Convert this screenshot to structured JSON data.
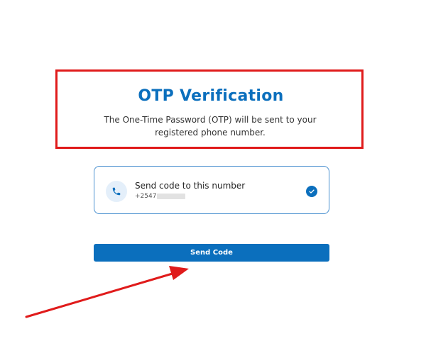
{
  "header": {
    "title": "OTP Verification",
    "subtitle": "The One-Time Password (OTP) will be sent to your registered phone number."
  },
  "phone_option": {
    "label": "Send code to this number",
    "number_prefix": "+2547",
    "selected": true,
    "icon": "phone-icon",
    "check_icon": "check-circle-icon"
  },
  "actions": {
    "send_code_label": "Send Code"
  },
  "colors": {
    "accent": "#0b6fbd",
    "annotation": "#e01b1b",
    "card_border": "#4a90d0"
  }
}
